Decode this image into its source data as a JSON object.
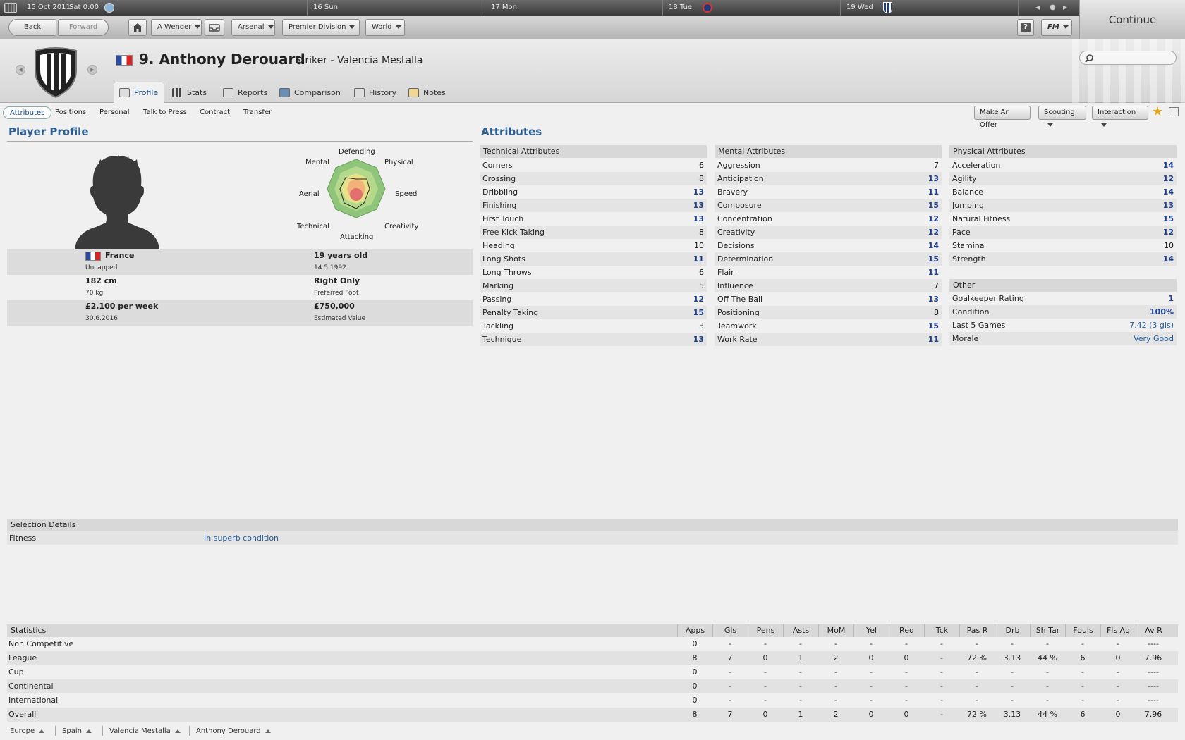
{
  "topbar": {
    "date": "15 Oct 2011",
    "time": "Sat 0:00",
    "days": [
      "16 Sun",
      "17 Mon",
      "18 Tue",
      "19 Wed"
    ],
    "continue_label": "Continue"
  },
  "nav": {
    "back": "Back",
    "forward": "Forward",
    "manager": "A Wenger",
    "club": "Arsenal",
    "league": "Premier Division",
    "world": "World",
    "help": "?",
    "fm": "FM"
  },
  "header": {
    "number_name": "9. Anthony Derouard",
    "position_club": "Striker - Valencia Mestalla",
    "search_placeholder": ""
  },
  "tabs": [
    "Profile",
    "Stats",
    "Reports",
    "Comparison",
    "History",
    "Notes"
  ],
  "subnav": [
    "Attributes",
    "Positions",
    "Personal",
    "Talk to Press",
    "Contract",
    "Transfer"
  ],
  "actions": {
    "offer": "Make An Offer",
    "scouting": "Scouting",
    "interaction": "Interaction"
  },
  "profile": {
    "title": "Player Profile",
    "radar_labels": [
      "Defending",
      "Physical",
      "Speed",
      "Creativity",
      "Attacking",
      "Technical",
      "Aerial",
      "Mental"
    ],
    "nationality": "France",
    "caps": "Uncapped",
    "age": "19 years old",
    "dob": "14.5.1992",
    "height": "182 cm",
    "weight": "70 kg",
    "foot": "Right Only",
    "foot_label": "Preferred Foot",
    "wage": "£2,100 per week",
    "contract_end": "30.6.2016",
    "value": "£750,000",
    "value_label": "Estimated Value"
  },
  "attributes": {
    "title": "Attributes",
    "technical_title": "Technical Attributes",
    "technical": [
      {
        "name": "Corners",
        "value": "6"
      },
      {
        "name": "Crossing",
        "value": "8"
      },
      {
        "name": "Dribbling",
        "value": "13"
      },
      {
        "name": "Finishing",
        "value": "13"
      },
      {
        "name": "First Touch",
        "value": "13"
      },
      {
        "name": "Free Kick Taking",
        "value": "8"
      },
      {
        "name": "Heading",
        "value": "10"
      },
      {
        "name": "Long Shots",
        "value": "11"
      },
      {
        "name": "Long Throws",
        "value": "6"
      },
      {
        "name": "Marking",
        "value": "5"
      },
      {
        "name": "Passing",
        "value": "12"
      },
      {
        "name": "Penalty Taking",
        "value": "15"
      },
      {
        "name": "Tackling",
        "value": "3"
      },
      {
        "name": "Technique",
        "value": "13"
      }
    ],
    "mental_title": "Mental Attributes",
    "mental": [
      {
        "name": "Aggression",
        "value": "7"
      },
      {
        "name": "Anticipation",
        "value": "13"
      },
      {
        "name": "Bravery",
        "value": "11"
      },
      {
        "name": "Composure",
        "value": "15"
      },
      {
        "name": "Concentration",
        "value": "12"
      },
      {
        "name": "Creativity",
        "value": "12"
      },
      {
        "name": "Decisions",
        "value": "14"
      },
      {
        "name": "Determination",
        "value": "15"
      },
      {
        "name": "Flair",
        "value": "11"
      },
      {
        "name": "Influence",
        "value": "7"
      },
      {
        "name": "Off The Ball",
        "value": "13"
      },
      {
        "name": "Positioning",
        "value": "8"
      },
      {
        "name": "Teamwork",
        "value": "15"
      },
      {
        "name": "Work Rate",
        "value": "11"
      }
    ],
    "physical_title": "Physical Attributes",
    "physical": [
      {
        "name": "Acceleration",
        "value": "14"
      },
      {
        "name": "Agility",
        "value": "12"
      },
      {
        "name": "Balance",
        "value": "14"
      },
      {
        "name": "Jumping",
        "value": "13"
      },
      {
        "name": "Natural Fitness",
        "value": "15"
      },
      {
        "name": "Pace",
        "value": "12"
      },
      {
        "name": "Stamina",
        "value": "10"
      },
      {
        "name": "Strength",
        "value": "14"
      }
    ],
    "other_title": "Other",
    "other": [
      {
        "name": "Goalkeeper Rating",
        "value": "1"
      },
      {
        "name": "Condition",
        "value": "100%"
      },
      {
        "name": "Last 5 Games",
        "value": "7.42 (3 gls)"
      },
      {
        "name": "Morale",
        "value": "Very Good"
      }
    ]
  },
  "selection": {
    "title": "Selection Details",
    "fitness_label": "Fitness",
    "fitness_value": "In superb condition"
  },
  "statistics": {
    "title": "Statistics",
    "columns": [
      "Apps",
      "Gls",
      "Pens",
      "Asts",
      "MoM",
      "Yel",
      "Red",
      "Tck",
      "Pas R",
      "Drb",
      "Sh Tar",
      "Fouls",
      "Fls Ag",
      "Av R"
    ],
    "rows": [
      {
        "label": "Non Competitive",
        "values": [
          "0",
          "-",
          "-",
          "-",
          "-",
          "-",
          "-",
          "-",
          "-",
          "-",
          "-",
          "-",
          "-",
          "----"
        ]
      },
      {
        "label": "League",
        "values": [
          "8",
          "7",
          "0",
          "1",
          "2",
          "0",
          "0",
          "-",
          "72 %",
          "3.13",
          "44 %",
          "6",
          "0",
          "7.96"
        ]
      },
      {
        "label": "Cup",
        "values": [
          "0",
          "-",
          "-",
          "-",
          "-",
          "-",
          "-",
          "-",
          "-",
          "-",
          "-",
          "-",
          "-",
          "----"
        ]
      },
      {
        "label": "Continental",
        "values": [
          "0",
          "-",
          "-",
          "-",
          "-",
          "-",
          "-",
          "-",
          "-",
          "-",
          "-",
          "-",
          "-",
          "----"
        ]
      },
      {
        "label": "International",
        "values": [
          "0",
          "-",
          "-",
          "-",
          "-",
          "-",
          "-",
          "-",
          "-",
          "-",
          "-",
          "-",
          "-",
          "----"
        ]
      },
      {
        "label": "Overall",
        "values": [
          "8",
          "7",
          "0",
          "1",
          "2",
          "0",
          "0",
          "-",
          "72 %",
          "3.13",
          "44 %",
          "6",
          "0",
          "7.96"
        ]
      }
    ]
  },
  "breadcrumbs": [
    "Europe",
    "Spain",
    "Valencia Mestalla",
    "Anthony Derouard"
  ]
}
